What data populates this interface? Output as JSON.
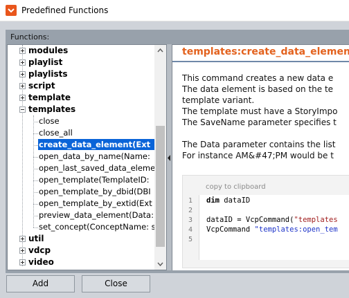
{
  "window": {
    "title": "Predefined Functions"
  },
  "panel": {
    "label": "Functions:"
  },
  "tree": {
    "top_before": [
      "modules",
      "playlist",
      "playlists",
      "script",
      "template"
    ],
    "expanded": "templates",
    "children": [
      "close",
      "close_all",
      "create_data_element(Ext",
      "open_data_by_name(Name:",
      "open_last_saved_data_eleme",
      "open_template(TemplateID:",
      "open_template_by_dbid(DBI",
      "open_template_by_extid(Ext",
      "preview_data_element(Data:",
      "set_concept(ConceptName: s"
    ],
    "selected_index": 2,
    "top_after": [
      "util",
      "vdcp",
      "video"
    ]
  },
  "doc": {
    "title": "templates:create_data_element",
    "paragraph1": [
      "This command creates a new data e",
      "The data element is based on the te",
      "template variant.",
      "The template must have a StoryImpo",
      "The SaveName parameter specifies t"
    ],
    "paragraph2": [
      "The Data parameter contains the list",
      "For instance AM&#47;PM would be t"
    ],
    "copy_link": "copy to clipboard",
    "code": {
      "line_numbers": [
        "1",
        "2",
        "3",
        "4",
        "5"
      ],
      "line1_kw": "dim",
      "line1_rest": " dataID",
      "line3_plain": "dataID = VcpCommand(",
      "line3_str": "\"templates",
      "line4_plain": "VcpCommand ",
      "line4_str": "\"templates:open_tem"
    }
  },
  "buttons": {
    "add": "Add",
    "close": "Close"
  }
}
